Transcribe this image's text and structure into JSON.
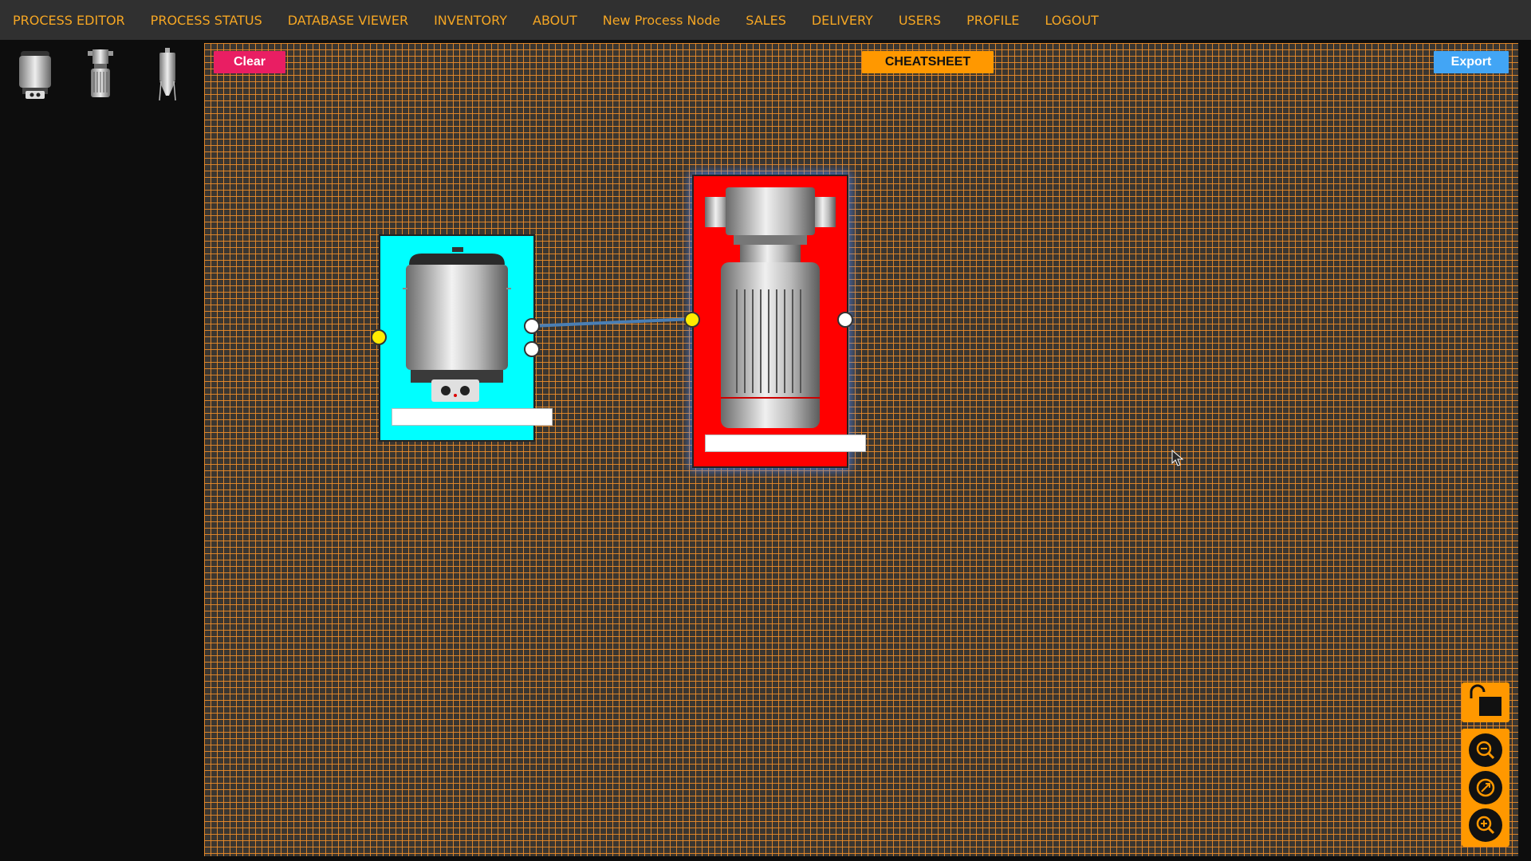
{
  "nav": {
    "items": [
      "PROCESS EDITOR",
      "PROCESS STATUS",
      "DATABASE VIEWER",
      "INVENTORY",
      "ABOUT",
      "New Process Node",
      "SALES",
      "DELIVERY",
      "USERS",
      "PROFILE",
      "LOGOUT"
    ]
  },
  "palette": {
    "items": [
      "kettle-icon",
      "pump-icon",
      "fermenter-icon"
    ]
  },
  "toolbar": {
    "clear_label": "Clear",
    "cheatsheet_label": "CHEATSHEET",
    "export_label": "Export"
  },
  "nodes": [
    {
      "name": "kettle-node",
      "background": "#00ffff",
      "label": "",
      "selected": false
    },
    {
      "name": "pump-node",
      "background": "#ff0000",
      "label": "",
      "selected": true
    }
  ],
  "controls": {
    "lock_icon": "unlock-icon",
    "zoom_out_icon": "zoom-out-icon",
    "fit_icon": "fit-view-icon",
    "zoom_in_icon": "zoom-in-icon"
  },
  "colors": {
    "nav_text": "#f5a623",
    "grid": "#ec8c28",
    "clear": "#e91e63",
    "cheatsheet": "#ff9800",
    "export": "#42a5f5",
    "edge": "#4a7fb5",
    "port_in": "#ffeb00",
    "port_out": "#ffffff"
  }
}
